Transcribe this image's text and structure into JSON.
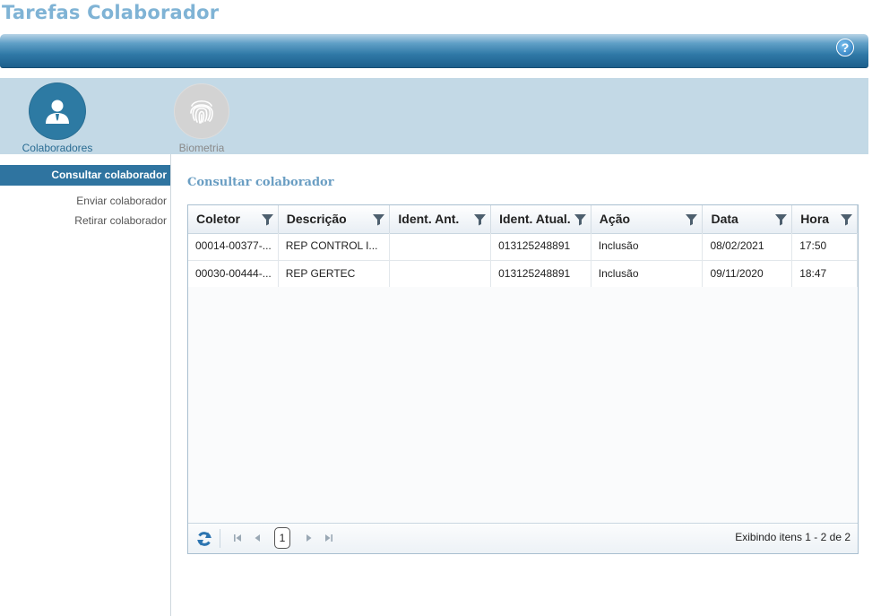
{
  "app": {
    "title": "Tarefas Colaborador"
  },
  "header": {
    "help_label": "?"
  },
  "modules": [
    {
      "label": "Colaboradores",
      "icon": "user-icon",
      "active": true
    },
    {
      "label": "Biometria",
      "icon": "fingerprint-icon",
      "active": false
    }
  ],
  "sidebar": {
    "items": [
      {
        "label": "Consultar colaborador",
        "active": true
      },
      {
        "label": "Enviar colaborador",
        "active": false
      },
      {
        "label": "Retirar colaborador",
        "active": false
      }
    ]
  },
  "main": {
    "title": "Consultar colaborador",
    "grid": {
      "columns": [
        "Coletor",
        "Descrição",
        "Ident. Ant.",
        "Ident. Atual.",
        "Ação",
        "Data",
        "Hora"
      ],
      "rows": [
        [
          "00014-00377-...",
          "REP CONTROL I...",
          "",
          "013125248891",
          "Inclusão",
          "08/02/2021",
          "17:50"
        ],
        [
          "00030-00444-...",
          "REP GERTEC",
          "",
          "013125248891",
          "Inclusão",
          "09/11/2020",
          "18:47"
        ]
      ]
    },
    "pager": {
      "current_page": "1",
      "info": "Exibindo itens 1 - 2 de 2"
    }
  },
  "colors": {
    "accent": "#2f74a0",
    "title": "#7fb3d5",
    "module_bar": "#c3d9e6"
  }
}
